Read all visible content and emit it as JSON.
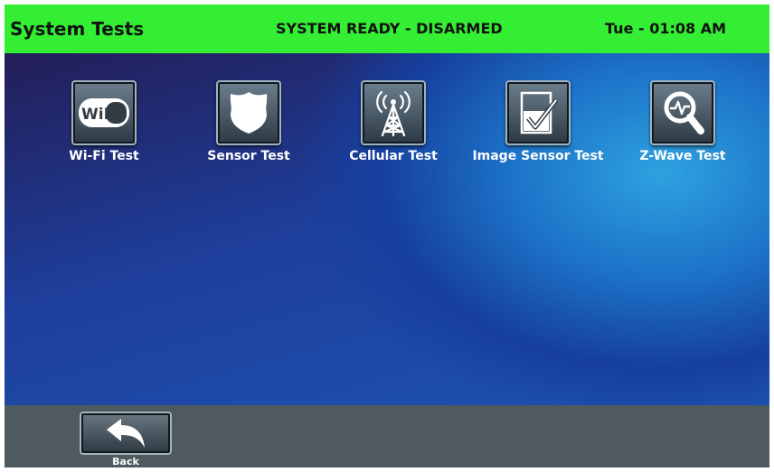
{
  "status_bar": {
    "title": "System Tests",
    "state": "SYSTEM READY - DISARMED",
    "clock": "Tue - 01:08 AM",
    "color": "#33ee33"
  },
  "tests": [
    {
      "label": "Wi-Fi Test",
      "icon": "wifi-icon",
      "icon_text": "WiFi"
    },
    {
      "label": "Sensor Test",
      "icon": "shield-icon"
    },
    {
      "label": "Cellular Test",
      "icon": "cell-tower-icon"
    },
    {
      "label": "Image Sensor Test",
      "icon": "image-sensor-icon"
    },
    {
      "label": "Z-Wave Test",
      "icon": "magnifier-icon"
    }
  ],
  "bottom_bar": {
    "back_label": "Back",
    "back_icon": "back-arrow-icon"
  }
}
